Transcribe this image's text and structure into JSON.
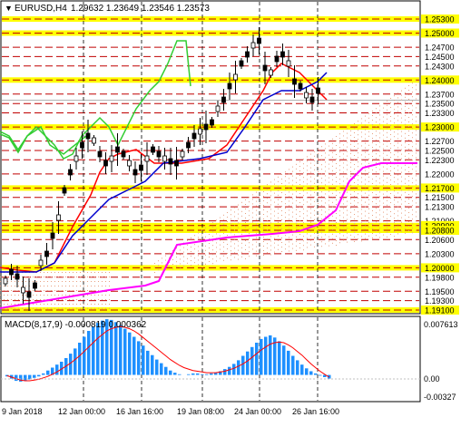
{
  "symbol": {
    "triangle": "▼",
    "header": "EURUSD,H4",
    "ohlc": "1.29632 1.23649 1.23546 1.23573"
  },
  "price_axis": {
    "current_price": "1.23573",
    "labels": [
      {
        "text": "1.25300",
        "hl": "yellow"
      },
      {
        "text": "1.25000",
        "hl": "yellow"
      },
      {
        "text": "1.24700",
        "hl": ""
      },
      {
        "text": "1.24500",
        "hl": ""
      },
      {
        "text": "1.24300",
        "hl": ""
      },
      {
        "text": "1.24000",
        "hl": "yellow"
      },
      {
        "text": "1.23700",
        "hl": ""
      },
      {
        "text": "1.23500",
        "hl": ""
      },
      {
        "text": "1.23300",
        "hl": ""
      },
      {
        "text": "1.23000",
        "hl": "yellow"
      },
      {
        "text": "1.22700",
        "hl": ""
      },
      {
        "text": "1.22500",
        "hl": ""
      },
      {
        "text": "1.22300",
        "hl": ""
      },
      {
        "text": "1.22000",
        "hl": ""
      },
      {
        "text": "1.21700",
        "hl": "yellow"
      },
      {
        "text": "1.21500",
        "hl": ""
      },
      {
        "text": "1.21300",
        "hl": ""
      },
      {
        "text": "1.21000",
        "hl": ""
      },
      {
        "text": "1.20900",
        "hl": "yellow"
      },
      {
        "text": "1.20800",
        "hl": "yellow"
      },
      {
        "text": "1.20600",
        "hl": ""
      },
      {
        "text": "1.20300",
        "hl": ""
      },
      {
        "text": "1.20000",
        "hl": "yellow"
      },
      {
        "text": "1.19800",
        "hl": ""
      },
      {
        "text": "1.19500",
        "hl": ""
      },
      {
        "text": "1.19300",
        "hl": ""
      },
      {
        "text": "1.19100",
        "hl": "yellow"
      }
    ]
  },
  "macd": {
    "label": "MACD(8,17,9) -0.000819 0.000362",
    "axis_top": "0.007613",
    "axis_zero": "0.00",
    "axis_bottom": "-0.00327",
    "histogram": [
      -0.2,
      -0.5,
      -0.8,
      -0.9,
      -0.8,
      -0.6,
      -0.4,
      -0.2,
      0.2,
      0.6,
      1.0,
      1.4,
      1.8,
      2.3,
      2.9,
      3.6,
      4.4,
      5.2,
      6.0,
      6.6,
      7.1,
      7.4,
      7.6,
      7.5,
      7.2,
      6.8,
      6.3,
      5.8,
      5.2,
      4.6,
      4.0,
      3.3,
      2.7,
      2.1,
      1.6,
      1.1,
      0.6,
      0.3,
      0.1,
      0.0,
      0.1,
      0.2,
      0.2,
      0.1,
      0.1,
      0.2,
      0.3,
      0.5,
      0.8,
      1.1,
      1.5,
      2.0,
      2.6,
      3.2,
      3.8,
      4.4,
      4.9,
      5.2,
      5.4,
      5.1,
      4.6,
      4.0,
      3.3,
      2.6,
      2.0,
      1.4,
      0.9,
      0.5,
      0.2,
      -0.1,
      -0.3,
      -0.5
    ],
    "signal": [
      -0.1,
      -0.3,
      -0.5,
      -0.7,
      -0.8,
      -0.8,
      -0.7,
      -0.6,
      -0.4,
      -0.2,
      0.1,
      0.4,
      0.8,
      1.2,
      1.6,
      2.1,
      2.6,
      3.2,
      3.8,
      4.4,
      5.0,
      5.5,
      6.0,
      6.3,
      6.5,
      6.6,
      6.5,
      6.3,
      6.0,
      5.6,
      5.1,
      4.6,
      4.1,
      3.6,
      3.1,
      2.6,
      2.1,
      1.7,
      1.3,
      1.0,
      0.8,
      0.6,
      0.5,
      0.4,
      0.3,
      0.3,
      0.3,
      0.4,
      0.5,
      0.7,
      0.9,
      1.2,
      1.5,
      1.9,
      2.4,
      2.9,
      3.4,
      3.8,
      4.2,
      4.4,
      4.5,
      4.4,
      4.1,
      3.7,
      3.2,
      2.7,
      2.1,
      1.5,
      1.0,
      0.5,
      0.1,
      -0.3
    ]
  },
  "time_axis": {
    "labels": [
      "9 Jan 2018",
      "12 Jan 00:00",
      "16 Jan 16:00",
      "19 Jan 08:00",
      "24 Jan 00:00",
      "26 Jan 16:00"
    ]
  },
  "colors": {
    "grid": "#c00000",
    "yellow": "#ffff00",
    "macd_hist": "#1e90ff",
    "signal": "#ff0000",
    "lime": "#32cd32",
    "magenta": "#ff00ff",
    "red_line": "#ff0000",
    "blue_line": "#0000cd",
    "cloud_dots": "#e8a080",
    "candles": "#000000"
  }
}
